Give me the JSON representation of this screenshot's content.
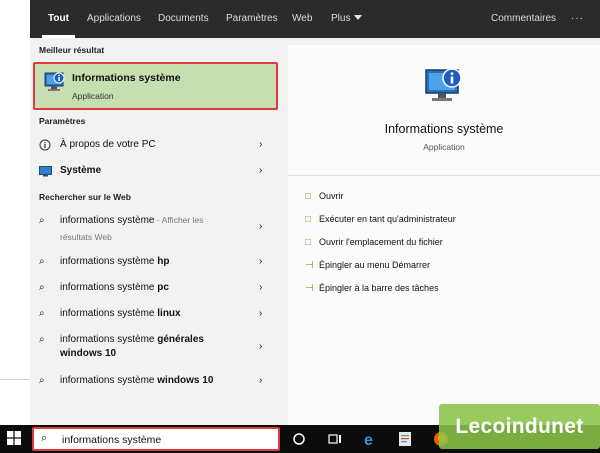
{
  "tabs": [
    {
      "label": "Tout",
      "active": true
    },
    {
      "label": "Applications"
    },
    {
      "label": "Documents"
    },
    {
      "label": "Paramètres"
    },
    {
      "label": "Web"
    },
    {
      "label": "Plus"
    }
  ],
  "feedback_label": "Commentaires",
  "more_label": "···",
  "best_match": {
    "section": "Meilleur résultat",
    "title": "Informations système",
    "subtitle": "Application",
    "icon": "system-info-icon"
  },
  "settings": {
    "section": "Paramètres",
    "items": [
      {
        "label": "À propos de votre PC",
        "icon": "info-icon"
      },
      {
        "label": "Système",
        "icon": "monitor-icon"
      }
    ]
  },
  "web": {
    "section": "Rechercher sur le Web",
    "items": [
      {
        "query": "informations système",
        "suffix": "",
        "hint": " - Afficher les",
        "hint2": "résultats Web"
      },
      {
        "query": "informations système ",
        "suffix": "hp"
      },
      {
        "query": "informations système ",
        "suffix": "pc"
      },
      {
        "query": "informations système ",
        "suffix": "linux"
      },
      {
        "query": "informations système ",
        "suffix": "générales",
        "line2": "windows 10"
      },
      {
        "query": "informations système ",
        "suffix": "windows 10"
      }
    ]
  },
  "detail": {
    "title": "Informations système",
    "subtitle": "Application",
    "actions": [
      {
        "label": "Ouvrir",
        "icon": "open-icon"
      },
      {
        "label": "Exécuter en tant qu'administrateur",
        "icon": "run-admin-icon"
      },
      {
        "label": "Ouvrir l'emplacement du fichier",
        "icon": "folder-icon"
      },
      {
        "label": "Épingler au menu Démarrer",
        "icon": "pin-icon"
      },
      {
        "label": "Épingler à la barre des tâches",
        "icon": "pin-icon"
      }
    ]
  },
  "search": {
    "value": "informations système"
  },
  "watermark": "Lecoindunet",
  "colors": {
    "highlight": "#c7deb1",
    "outline": "#e0393e",
    "accent": "#6aaa2d",
    "topbar": "#2b2b2b",
    "taskbar": "#0b0b0b"
  }
}
